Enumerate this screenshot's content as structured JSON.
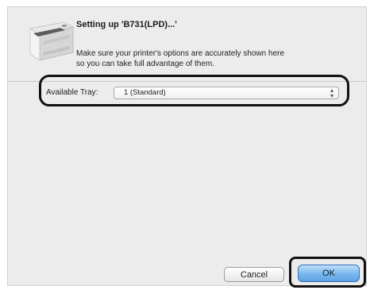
{
  "dialog": {
    "title": "Setting up 'B731(LPD)...'",
    "message_line1": "Make sure your printer's options are accurately shown here",
    "message_line2": "so you can take full advantage of them.",
    "icon": "printer-icon"
  },
  "tray": {
    "label": "Available Tray:",
    "selected": "1 (Standard)"
  },
  "buttons": {
    "cancel": "Cancel",
    "ok": "OK"
  },
  "colors": {
    "background": "#ececec",
    "default_button": "#78b6ee"
  }
}
